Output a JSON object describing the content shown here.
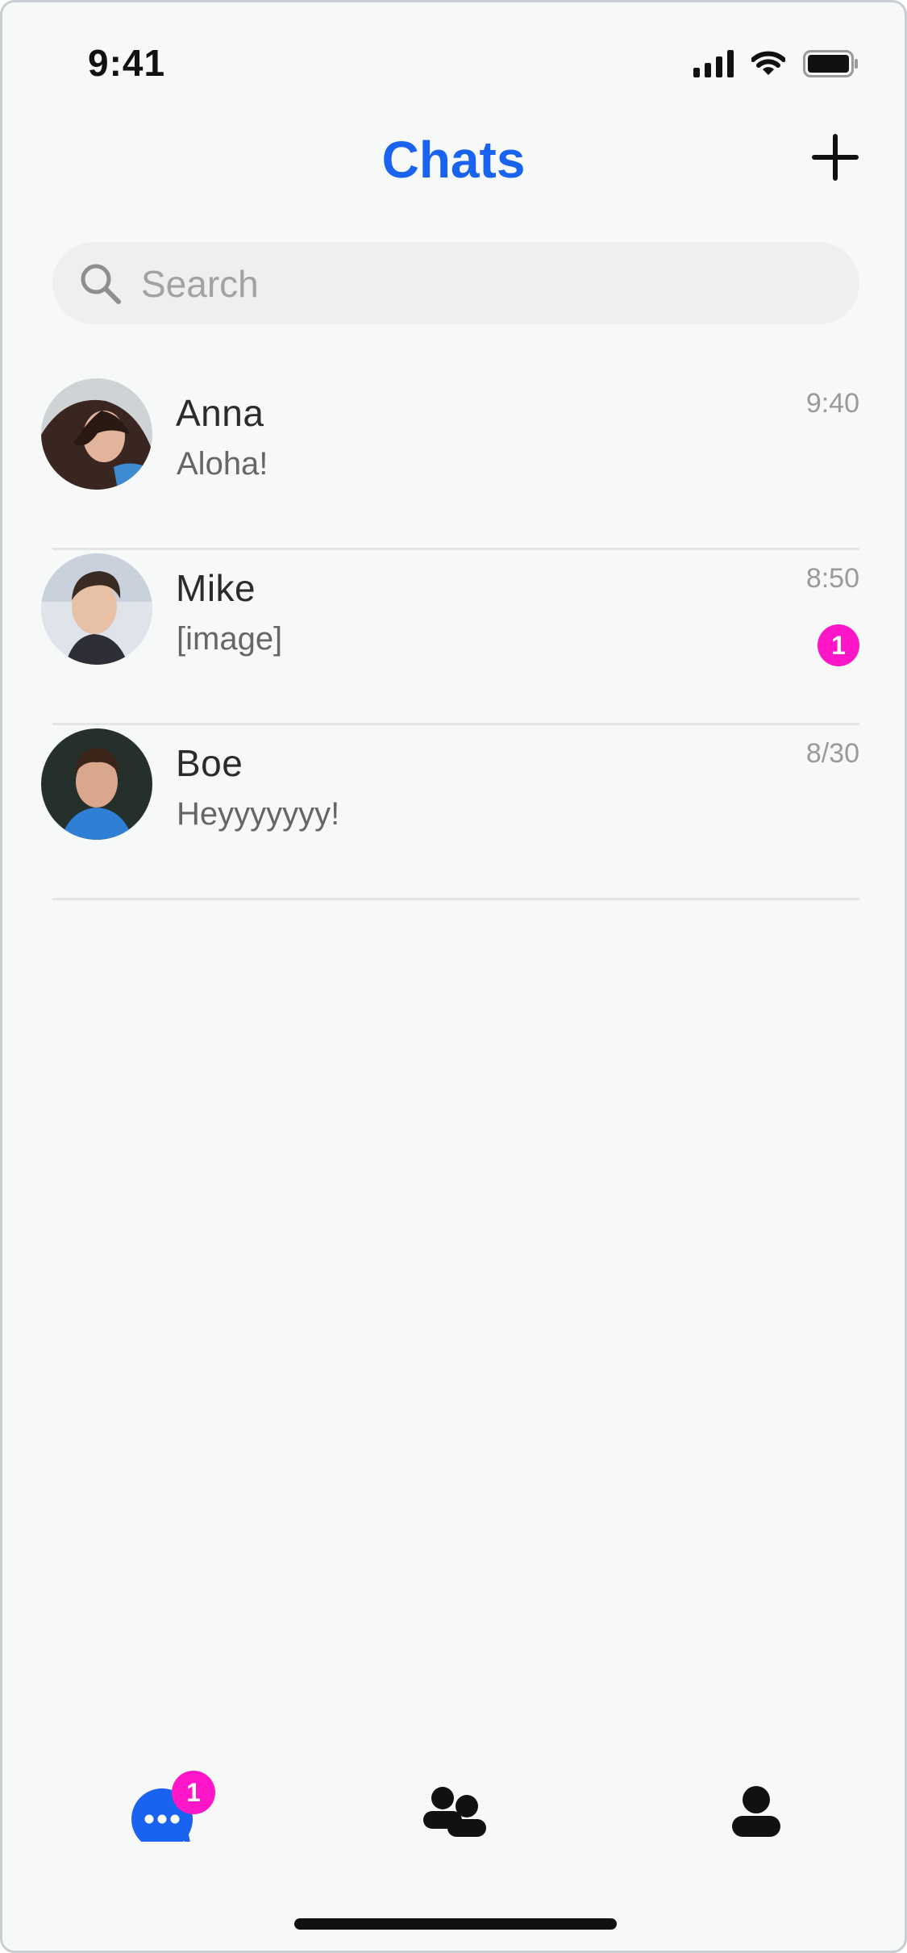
{
  "status_bar": {
    "time": "9:41"
  },
  "header": {
    "title": "Chats",
    "add_icon": "plus-icon"
  },
  "search": {
    "placeholder": "Search",
    "value": ""
  },
  "chats": [
    {
      "name": "Anna",
      "preview": "Aloha!",
      "time": "9:40",
      "unread": ""
    },
    {
      "name": "Mike",
      "preview": "[image]",
      "time": "8:50",
      "unread": "1"
    },
    {
      "name": "Boe",
      "preview": "Heyyyyyyy!",
      "time": "8/30",
      "unread": ""
    }
  ],
  "tab_bar": {
    "tabs": [
      {
        "icon": "chat-bubble-icon",
        "active": true
      },
      {
        "icon": "contacts-icon",
        "active": false
      },
      {
        "icon": "profile-icon",
        "active": false
      }
    ],
    "chats_badge": "1"
  },
  "colors": {
    "accent": "#1a63f0",
    "badge": "#ff16c8",
    "background": "#f7f9f9"
  }
}
